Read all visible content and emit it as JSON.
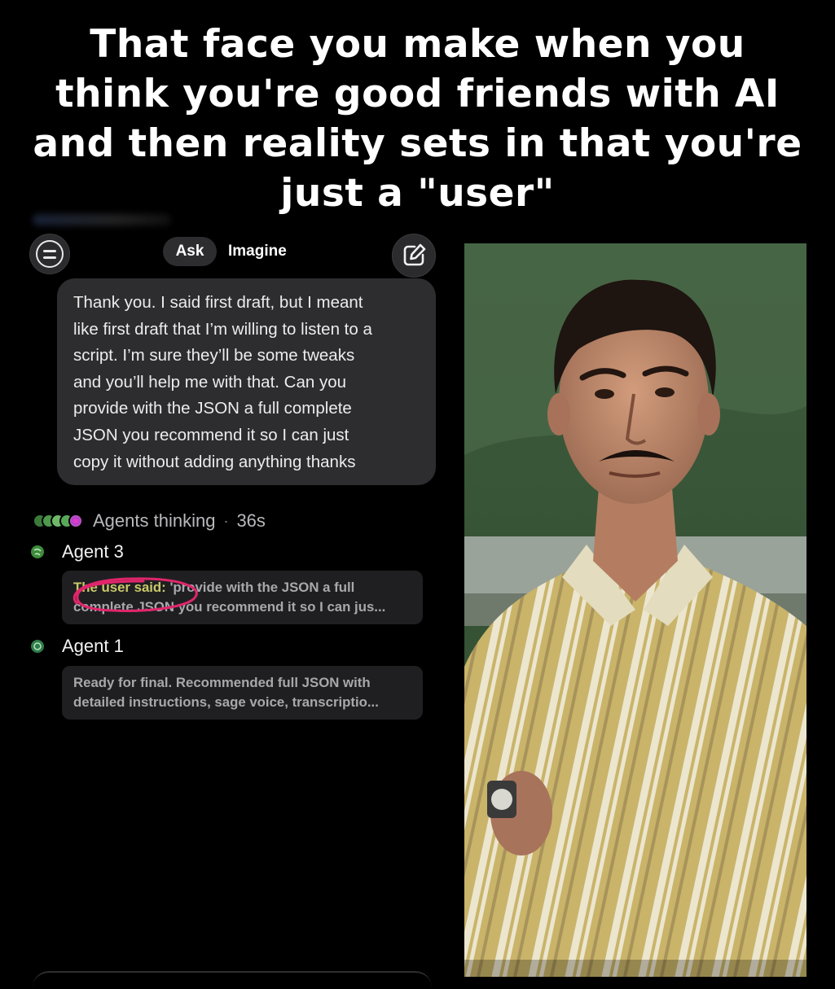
{
  "caption": "That face you make when you think you're good friends with AI and then reality sets in that you're just a \"user\"",
  "phone": {
    "tabs": {
      "ask": "Ask",
      "imagine": "Imagine"
    },
    "message_lines": [
      "Thank you. I said first draft, but I meant",
      "like first draft that I’m willing to listen to a",
      "script.  I’m sure they’ll be some tweaks",
      "and you’ll help me with that.  Can you",
      "provide with the JSON a full complete",
      "JSON you recommend it so I can just",
      "copy it without adding anything thanks"
    ],
    "thinking": {
      "label": "Agents thinking",
      "separator": "·",
      "time": "36s"
    },
    "agents": [
      {
        "name": "Agent 3",
        "highlight": "The user said:",
        "line1_rest": " 'provide with the JSON a full",
        "line2": "complete JSON you recommend it so I can jus..."
      },
      {
        "name": "Agent 1",
        "line1": "Ready for final. Recommended full JSON with",
        "line2": "detailed instructions, sage voice, transcriptio..."
      }
    ]
  },
  "colors": {
    "background": "#000000",
    "bubble": "#2d2d30",
    "card": "#1f1f22",
    "highlight_text": "#c9c96a",
    "annotation_circle": "#e0266b"
  },
  "icons": [
    "menu-icon",
    "compose-icon",
    "agent-avatar-icon",
    "globe-icon"
  ]
}
